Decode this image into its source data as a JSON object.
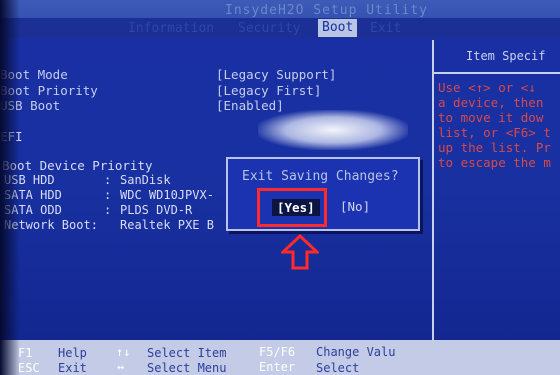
{
  "header": {
    "title": "InsydeH2O Setup Utility",
    "tabs": [
      {
        "label": "Information"
      },
      {
        "label": "Security"
      },
      {
        "label": "Boot"
      },
      {
        "label": "Exit"
      }
    ],
    "active_tab": "Boot"
  },
  "settings": [
    {
      "label": "Boot Mode",
      "value": "[Legacy Support]"
    },
    {
      "label": "Boot Priority",
      "value": "[Legacy First]"
    },
    {
      "label": "USB Boot",
      "value": "[Enabled]"
    }
  ],
  "efi_label": "EFI",
  "boot_priority": {
    "heading": "Boot Device Priority",
    "devices": [
      {
        "name": "USB HDD",
        "sep": ":",
        "value": "SanDisk"
      },
      {
        "name": "SATA HDD",
        "sep": ":",
        "value": "WDC WD10JPVX-"
      },
      {
        "name": "SATA ODD",
        "sep": ":",
        "value": "PLDS    DVD-R"
      },
      {
        "name": "Network Boot:",
        "sep": "",
        "value": "Realtek PXE B"
      }
    ]
  },
  "help_panel": {
    "header": "Item Specif",
    "lines": [
      "Use <↑> or <↓",
      "a device, then",
      "to move it dow",
      "list, or <F6> t",
      "up the list. Pr",
      "to escape the m"
    ]
  },
  "dialog": {
    "title": "Exit Saving Changes?",
    "yes": "[Yes]",
    "no": "[No]"
  },
  "footer": {
    "row1": [
      {
        "key": "F1",
        "desc": "Help"
      },
      {
        "key": "↑↓",
        "desc": "Select Item"
      },
      {
        "key": "F5/F6",
        "desc": "Change Valu"
      }
    ],
    "row2": [
      {
        "key": "ESC",
        "desc": "Exit"
      },
      {
        "key": "↔",
        "desc": "Select Menu"
      },
      {
        "key": "Enter",
        "desc": "Select"
      }
    ]
  },
  "colors": {
    "background": "#1a2fa5",
    "annotation": "#ff2a2a"
  }
}
